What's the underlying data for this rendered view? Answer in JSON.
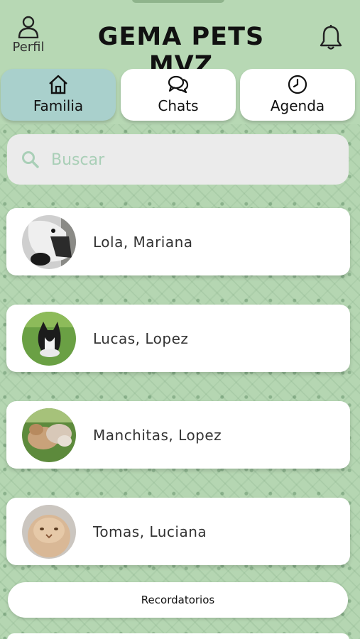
{
  "app": {
    "title": "GEMA PETS MVZ",
    "profile_label": "Perfil"
  },
  "tabs": [
    {
      "label": "Familia",
      "icon": "home-icon",
      "active": true
    },
    {
      "label": "Chats",
      "icon": "chat-bubbles-icon",
      "active": false
    },
    {
      "label": "Agenda",
      "icon": "clock-icon",
      "active": false
    }
  ],
  "search": {
    "placeholder": "Buscar",
    "value": ""
  },
  "contacts": [
    {
      "name": "Lola, Mariana",
      "avatar": "dog-borzoi-photo"
    },
    {
      "name": "Lucas, Lopez",
      "avatar": "dog-puppy-on-grass-photo"
    },
    {
      "name": "Manchitas, Lopez",
      "avatar": "rabbits-on-grass-photo"
    },
    {
      "name": "Tomas, Luciana",
      "avatar": "persian-cat-photo"
    }
  ],
  "reminders_label": "Recordatorios",
  "colors": {
    "background": "#b7d8b4",
    "active_tab": "#a9d0cc",
    "search_bg": "#ebebeb",
    "search_accent": "#a9cfb7"
  }
}
